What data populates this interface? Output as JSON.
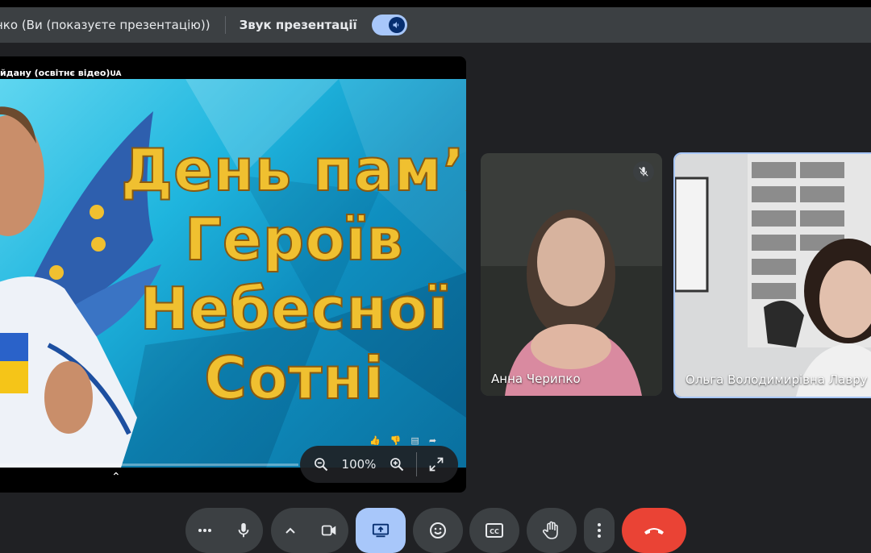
{
  "presentation_bar": {
    "presenter_label": "нко (Ви (показуєте презентацію))",
    "sound_label": "Звук презентації",
    "sound_toggle_on": true
  },
  "presentation": {
    "video_title": "йдану (освітнє відео)",
    "video_title_suffix": "UA",
    "slide_lines": [
      "День пам’яті",
      "Героїв",
      "Небесної",
      "Сотні"
    ],
    "zoom_level": "100%"
  },
  "participants": [
    {
      "name": "Анна Черипко",
      "muted": true
    },
    {
      "name": "Ольга Володимирівна Лавру"
    }
  ],
  "controls": {
    "more_options_icon": "more-horiz-icon",
    "mic_icon": "mic-icon",
    "expand_icon": "chevron-up-icon",
    "camera_icon": "videocam-icon",
    "present_icon": "present-screen-icon",
    "emoji_icon": "emoji-icon",
    "captions_icon": "closed-captions-icon",
    "raise_hand_icon": "raise-hand-icon",
    "kebab_icon": "more-vert-icon",
    "leave_icon": "call-end-icon"
  },
  "colors": {
    "background": "#202124",
    "accent": "#a8c7fa",
    "leave": "#ea4335",
    "slide_text": "#f0c030"
  }
}
